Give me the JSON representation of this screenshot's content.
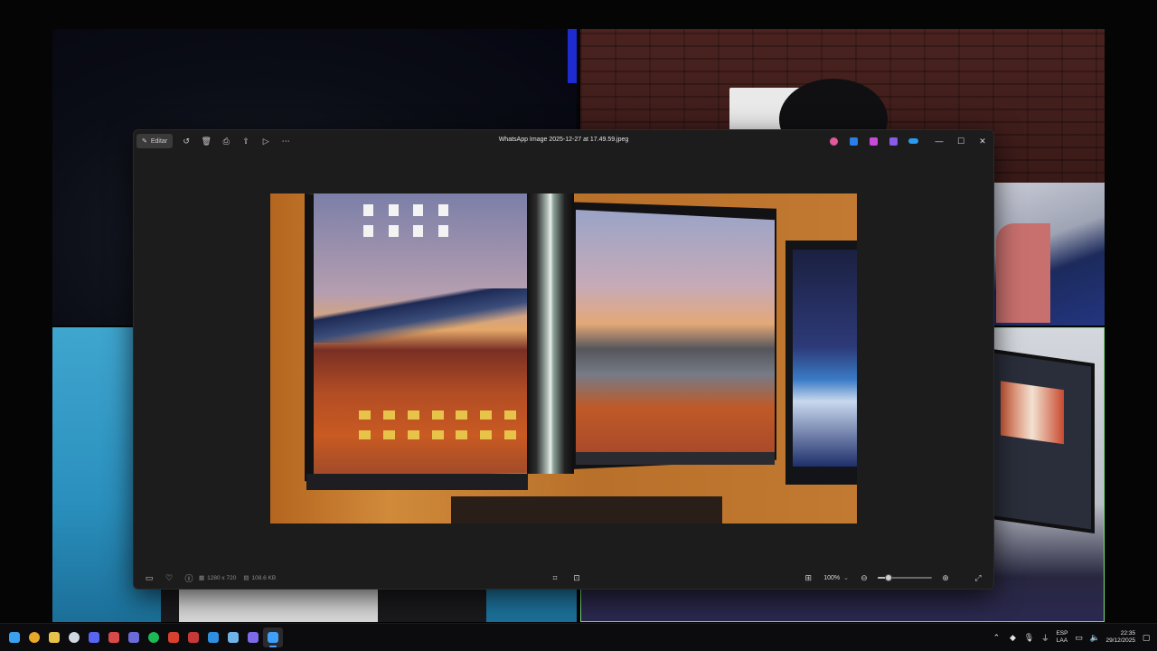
{
  "viewer": {
    "title": "WhatsApp Image 2025-12-27 at 17.49.59.jpeg",
    "toolbar": {
      "edit_label": "Editar",
      "tools": [
        "rotate-icon",
        "delete-icon",
        "print-icon",
        "share-icon",
        "slideshow-icon",
        "more-icon"
      ]
    },
    "app_icons": [
      {
        "name": "copilot-icon",
        "color": "#e05a9c"
      },
      {
        "name": "designer-icon",
        "color": "#2b7de9"
      },
      {
        "name": "clipchamp-icon",
        "color": "#c84bd8"
      },
      {
        "name": "app-icon",
        "color": "#8a5ae8"
      },
      {
        "name": "onedrive-icon",
        "color": "#2b9bf0"
      }
    ],
    "bottom": {
      "dimensions": "1280 x 720",
      "file_size": "108.6 KB",
      "zoom": "100%",
      "zoom_level": 0.2
    }
  },
  "taskbar": {
    "apps": [
      {
        "name": "start-icon",
        "color": "#3aa0f0"
      },
      {
        "name": "chrome-icon",
        "color": "#e8a92a"
      },
      {
        "name": "file-explorer-icon",
        "color": "#e8c34a"
      },
      {
        "name": "steam-icon",
        "color": "#cfd8e0"
      },
      {
        "name": "discord-icon",
        "color": "#5865f2"
      },
      {
        "name": "app-icon",
        "color": "#d84a4a"
      },
      {
        "name": "teams-icon",
        "color": "#6b6bd8"
      },
      {
        "name": "spotify-icon",
        "color": "#1db954"
      },
      {
        "name": "app-icon",
        "color": "#d9412f"
      },
      {
        "name": "app-icon",
        "color": "#c73838"
      },
      {
        "name": "app-icon",
        "color": "#2f8ee0"
      },
      {
        "name": "app-icon",
        "color": "#6fb4e8"
      },
      {
        "name": "app-icon",
        "color": "#7e6ae6"
      },
      {
        "name": "photos-icon",
        "color": "#3fa0f5",
        "active": true
      }
    ],
    "language_top": "ESP",
    "language_bottom": "LAA",
    "time": "22:35",
    "date": "29/12/2025"
  }
}
